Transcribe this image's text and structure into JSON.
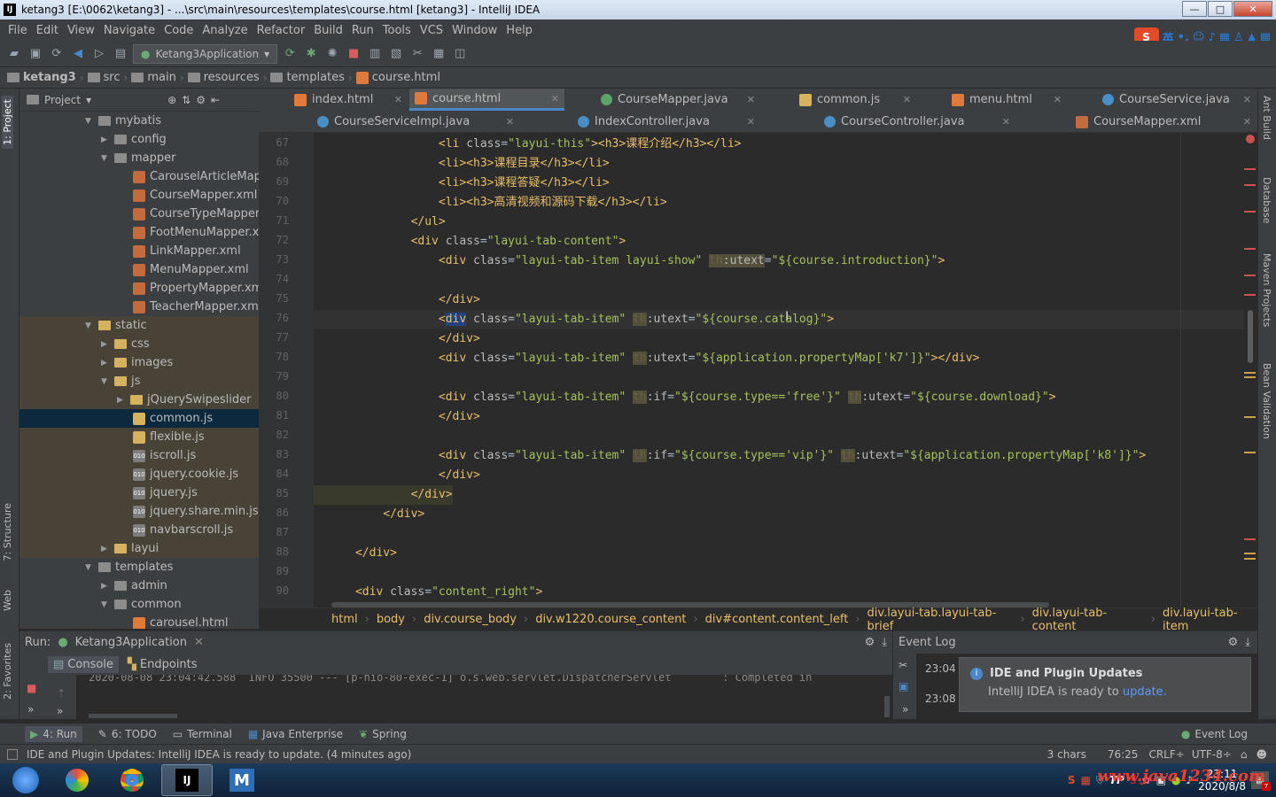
{
  "window": {
    "title": "ketang3 [E:\\0062\\ketang3] - ...\\src\\main\\resources\\templates\\course.html [ketang3] - IntelliJ IDEA",
    "min_symbol": "—",
    "max_symbol": "□",
    "close_symbol": "✕"
  },
  "menu": [
    "File",
    "Edit",
    "View",
    "Navigate",
    "Code",
    "Analyze",
    "Refactor",
    "Build",
    "Run",
    "Tools",
    "VCS",
    "Window",
    "Help"
  ],
  "ime": {
    "mode_label": "英",
    "brand": "S"
  },
  "toolbar": {
    "run_config": "Ketang3Application"
  },
  "navbar": [
    "ketang3",
    "src",
    "main",
    "resources",
    "templates",
    "course.html"
  ],
  "left_strip": {
    "project": "1: Project",
    "structure": "7: Structure",
    "web": "Web",
    "favorites": "2: Favorites"
  },
  "right_strip": {
    "ant": "Ant Build",
    "database": "Database",
    "maven": "Maven Projects",
    "bean": "Bean Validation"
  },
  "project_panel": {
    "title": "Project"
  },
  "tree": [
    {
      "label": "mybatis"
    },
    {
      "label": "config"
    },
    {
      "label": "mapper"
    },
    {
      "label": "CarouselArticleMapp"
    },
    {
      "label": "CourseMapper.xml"
    },
    {
      "label": "CourseTypeMapper.x"
    },
    {
      "label": "FootMenuMapper.xn"
    },
    {
      "label": "LinkMapper.xml"
    },
    {
      "label": "MenuMapper.xml"
    },
    {
      "label": "PropertyMapper.xml"
    },
    {
      "label": "TeacherMapper.xml"
    },
    {
      "label": "static"
    },
    {
      "label": "css"
    },
    {
      "label": "images"
    },
    {
      "label": "js"
    },
    {
      "label": "jQuerySwipeslider"
    },
    {
      "label": "common.js"
    },
    {
      "label": "flexible.js"
    },
    {
      "label": "iscroll.js"
    },
    {
      "label": "jquery.cookie.js"
    },
    {
      "label": "jquery.js"
    },
    {
      "label": "jquery.share.min.js"
    },
    {
      "label": "navbarscroll.js"
    },
    {
      "label": "layui"
    },
    {
      "label": "templates"
    },
    {
      "label": "admin"
    },
    {
      "label": "common"
    },
    {
      "label": "carousel.html"
    }
  ],
  "tabs_row1": [
    "index.html",
    "course.html",
    "CourseMapper.java",
    "common.js",
    "menu.html",
    "CourseService.java"
  ],
  "tabs_row2": [
    "CourseServiceImpl.java",
    "IndexController.java",
    "CourseController.java",
    "CourseMapper.xml"
  ],
  "line_numbers": [
    "67",
    "68",
    "69",
    "70",
    "71",
    "72",
    "73",
    "74",
    "75",
    "76",
    "77",
    "78",
    "79",
    "80",
    "81",
    "82",
    "83",
    "84",
    "85",
    "86",
    "87",
    "88",
    "89",
    "90"
  ],
  "code": {
    "l67a": "                  <li ",
    "l67b": "class",
    "l67c": "=",
    "l67d": "\"layui-this\"",
    "l67e": "><h3>课程介绍</h3></li>",
    "l68": "                  <li><h3>课程目录</h3></li>",
    "l69": "                  <li><h3>课程答疑</h3></li>",
    "l70": "                  <li><h3>高清视频和源码下载</h3></li>",
    "l71": "              </ul>",
    "l72a": "              <div ",
    "l72b": "class",
    "l72c": "=",
    "l72d": "\"layui-tab-content\"",
    "l72e": ">",
    "l73a": "                  <div ",
    "l73b": "class",
    "l73c": "=",
    "l73d": "\"layui-tab-item layui-show\"",
    "l73e": " ",
    "l73f": "th",
    "l73g": ":utext",
    "l73h": "=",
    "l73i": "\"${course.introduction}\"",
    "l73j": ">",
    "l75": "                  </div>",
    "l76a": "                  <",
    "l76b": "div",
    "l76c": " class",
    "l76d": "=",
    "l76e": "\"layui-tab-item\"",
    "l76f": " ",
    "l76g": "th",
    "l76h": ":utext",
    "l76i": "=",
    "l76j": "\"${course.catalog}\"",
    "l76k": ">",
    "l77": "                  </div>",
    "l78a": "                  <div ",
    "l78b": "class",
    "l78c": "=",
    "l78d": "\"layui-tab-item\"",
    "l78e": " ",
    "l78f": "th",
    "l78g": ":utext",
    "l78h": "=",
    "l78i": "\"${application.propertyMap['k7']}\"",
    "l78j": "></div>",
    "l80a": "                  <div ",
    "l80b": "class",
    "l80c": "=",
    "l80d": "\"layui-tab-item\"",
    "l80e": " ",
    "l80f": "th",
    "l80g": ":if",
    "l80h": "=",
    "l80i": "\"${course.type=='free'}\"",
    "l80j": " ",
    "l80k": "th",
    "l80l": ":utext",
    "l80m": "=",
    "l80n": "\"${course.download}\"",
    "l80o": ">",
    "l81": "                  </div>",
    "l83a": "                  <div ",
    "l83b": "class",
    "l83c": "=",
    "l83d": "\"layui-tab-item\"",
    "l83e": " ",
    "l83f": "th",
    "l83g": ":if",
    "l83h": "=",
    "l83i": "\"${course.type=='vip'}\"",
    "l83j": " ",
    "l83k": "th",
    "l83l": ":utext",
    "l83m": "=",
    "l83n": "\"${application.propertyMap['k8']}\"",
    "l83o": ">",
    "l84": "                  </div>",
    "l85": "              </div>",
    "l86": "          </div>",
    "l88": "      </div>",
    "l90a": "      <div ",
    "l90b": "class",
    "l90c": "=",
    "l90d": "\"content_right\"",
    "l90e": ">"
  },
  "breadcrumbs": [
    "html",
    "body",
    "div.course_body",
    "div.w1220.course_content",
    "div#content.content_left",
    "div.layui-tab.layui-tab-brief",
    "div.layui-tab-content",
    "div.layui-tab-item"
  ],
  "run_panel": {
    "label": "Run:",
    "config": "Ketang3Application",
    "tab_console": "Console",
    "tab_endpoints": "Endpoints",
    "console_line": "2020-08-08 23:04:42.588  INFO 35500 --- [p-nio-80-exec-1] o.s.web.servlet.DispatcherServlet        : Completed in"
  },
  "event_log": {
    "title": "Event Log",
    "time1": "23:04",
    "time2": "23:08",
    "notif_title": "IDE and Plugin Updates",
    "notif_text": "IntelliJ IDEA is ready to ",
    "notif_link": "update."
  },
  "bottom_tabs": [
    "4: Run",
    "6: TODO",
    "Terminal",
    "Java Enterprise",
    "Spring"
  ],
  "bottom_right": "Event Log",
  "status": {
    "message": "IDE and Plugin Updates: IntelliJ IDEA is ready to update. (4 minutes ago)",
    "chars": "3 chars",
    "position": "76:25",
    "line_sep": "CRLF÷",
    "encoding": "UTF-8÷"
  },
  "taskbar": {
    "time": "23:11",
    "date": "2020/8/8",
    "watermark": "www.java1234.com"
  }
}
